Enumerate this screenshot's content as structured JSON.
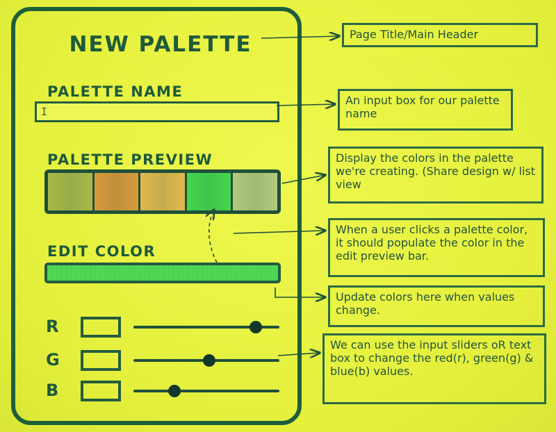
{
  "wireframe": {
    "title": "NEW PALETTE",
    "palette_name_label": "PALETTE NAME",
    "palette_name_value": "I",
    "palette_preview_label": "PALETTE PREVIEW",
    "edit_color_label": "EDIT COLOR",
    "preview_swatches": [
      "#aab94a",
      "#d89a3c",
      "#e0b94e",
      "#45d64e",
      "#b4c97e"
    ],
    "edit_color": "#4fd652",
    "rgb": [
      {
        "letter": "R",
        "slider_fraction": 0.84
      },
      {
        "letter": "G",
        "slider_fraction": 0.52
      },
      {
        "letter": "B",
        "slider_fraction": 0.28
      }
    ]
  },
  "annotations": [
    "Page Title/Main Header",
    "An input box for our palette name",
    "Display the colors in the palette we're creating. (Share design w/ list view",
    "When a user clicks a palette color, it should populate the color in the edit preview bar.",
    "Update colors here when values change.",
    "We can use the input sliders oR text box to change the red(r), green(g) & blue(b) values."
  ],
  "colors": {
    "paper": "#e9f542",
    "ink": "#1f5e3a"
  }
}
